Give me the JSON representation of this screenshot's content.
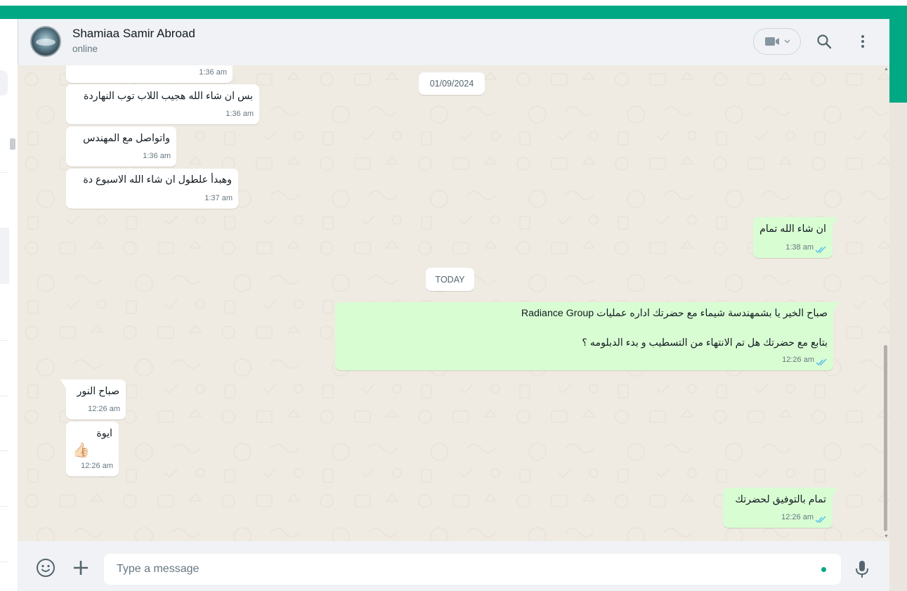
{
  "header": {
    "contact_name": "Shamiaa Samir Abroad",
    "status": "online",
    "icons": [
      "video-call-icon",
      "chevron-down-icon",
      "search-icon",
      "menu-icon"
    ]
  },
  "messages": [
    {
      "dir": "in",
      "text": "",
      "time": "1:36 am"
    },
    {
      "dir": "in",
      "text": "بس ان شاء الله هجيب اللاب توب النهاردة",
      "time": "1:36 am"
    },
    {
      "dir": "in",
      "text": "واتواصل مع المهندس",
      "time": "1:36 am"
    },
    {
      "dir": "in",
      "text": "وهبدأ علطول ان شاء الله الاسبوع دة",
      "time": "1:37 am"
    },
    {
      "dir": "out",
      "text": "ان شاء الله تمام",
      "time": "1:38 am",
      "status": "read"
    },
    {
      "dir": "out",
      "line1": "صباح الخير يا بشمهندسة شيماء مع  حضرتك اداره عمليات Radiance Group",
      "line2": "بتابع مع حضرتك هل تم الانتهاء من التسطيب و بدء الدبلومه ؟",
      "time": "12:26 am",
      "status": "read"
    },
    {
      "dir": "in",
      "text": "صباح النور",
      "time": "12:26 am"
    },
    {
      "dir": "in",
      "text": "ايوة",
      "emoji": "👍🏻",
      "time": "12:26 am"
    },
    {
      "dir": "out",
      "text": "تمام بالتوفيق لحضرتك",
      "time": "12:26 am",
      "status": "read"
    }
  ],
  "date_separators": {
    "first": "01/09/2024",
    "second": "TODAY"
  },
  "footer": {
    "placeholder": "Type a message",
    "icons": [
      "emoji-icon",
      "attach-plus-icon",
      "microphone-icon"
    ]
  },
  "colors": {
    "accent": "#00a884",
    "outgoing_bubble": "#d9fdd3",
    "incoming_bubble": "#ffffff",
    "chat_background": "#efeae2",
    "read_ticks": "#53bdeb"
  }
}
